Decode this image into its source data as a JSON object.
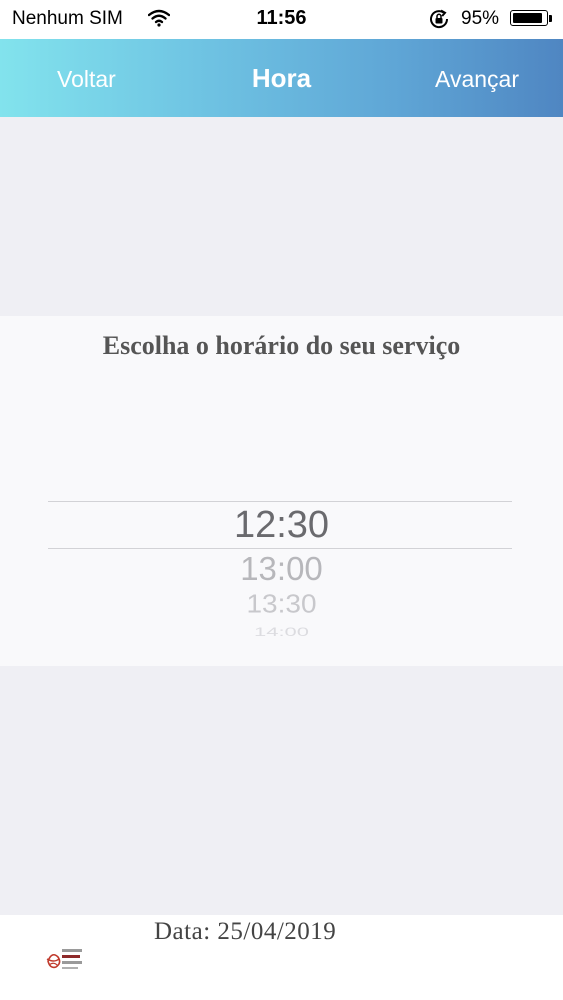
{
  "status_bar": {
    "carrier": "Nenhum SIM",
    "time": "11:56",
    "battery_percent": "95%",
    "battery_level": 0.95
  },
  "nav": {
    "back_label": "Voltar",
    "title": "Hora",
    "next_label": "Avançar"
  },
  "picker": {
    "title": "Escolha o horário do seu serviço",
    "selected": "12:30",
    "options": [
      "13:00",
      "13:30",
      "14:00"
    ]
  },
  "footer": {
    "date_label": "Data:",
    "date_value": "25/04/2019"
  },
  "colors": {
    "nav_gradient_start": "#82e3ed",
    "nav_gradient_end": "#4f86c2",
    "background": "#efeff4"
  }
}
